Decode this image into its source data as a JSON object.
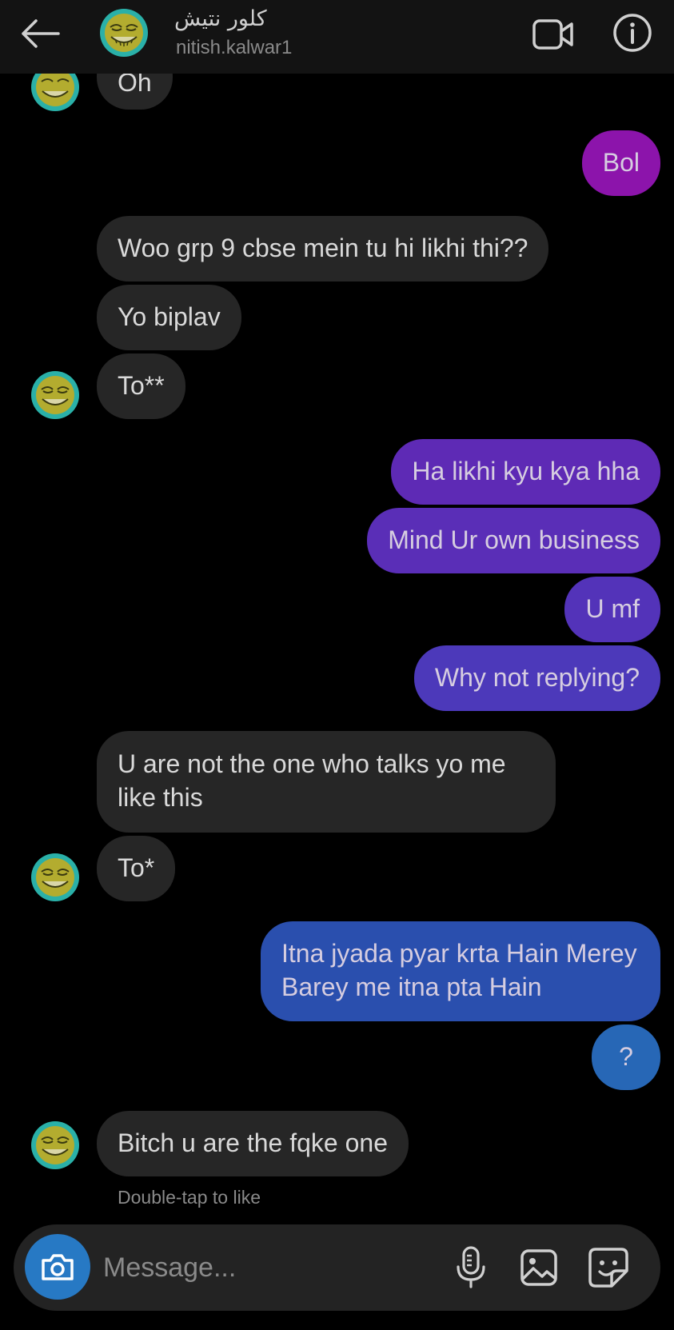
{
  "header": {
    "contact_name": "كلور نتيش",
    "contact_handle": "nitish.kalwar1",
    "icons": {
      "back": "arrow-left-icon",
      "video": "video-call-icon",
      "info": "info-icon"
    }
  },
  "messages": [
    {
      "text": "Oh",
      "direction": "incoming"
    },
    {
      "text": "Bol",
      "direction": "outgoing",
      "color": "#8c14ab"
    },
    {
      "text": "Woo grp 9 cbse mein tu hi likhi thi??",
      "direction": "incoming"
    },
    {
      "text": "Yo biplav",
      "direction": "incoming"
    },
    {
      "text": "To**",
      "direction": "incoming"
    },
    {
      "text": "Ha likhi kyu kya hha",
      "direction": "outgoing",
      "color": "#5e2ab5"
    },
    {
      "text": "Mind Ur own business",
      "direction": "outgoing",
      "color": "#5a2eb7"
    },
    {
      "text": "U mf",
      "direction": "outgoing",
      "color": "#5333b9"
    },
    {
      "text": "Why not replying?",
      "direction": "outgoing",
      "color": "#4c39ba"
    },
    {
      "text": "U are not the one who talks yo me like this",
      "direction": "incoming"
    },
    {
      "text": "To*",
      "direction": "incoming"
    },
    {
      "text": "Itna  jyada pyar krta Hain Merey Barey me itna pta Hain",
      "direction": "outgoing",
      "color": "#2a4fae"
    },
    {
      "text": "?",
      "direction": "outgoing",
      "color": "#2767b6"
    },
    {
      "text": "Bitch u are the fqke one",
      "direction": "incoming"
    }
  ],
  "hint": "Double-tap to like",
  "composer": {
    "placeholder": "Message...",
    "camera_color": "#2779c4",
    "icons": [
      "camera-icon",
      "microphone-icon",
      "gallery-icon",
      "sticker-icon"
    ]
  }
}
